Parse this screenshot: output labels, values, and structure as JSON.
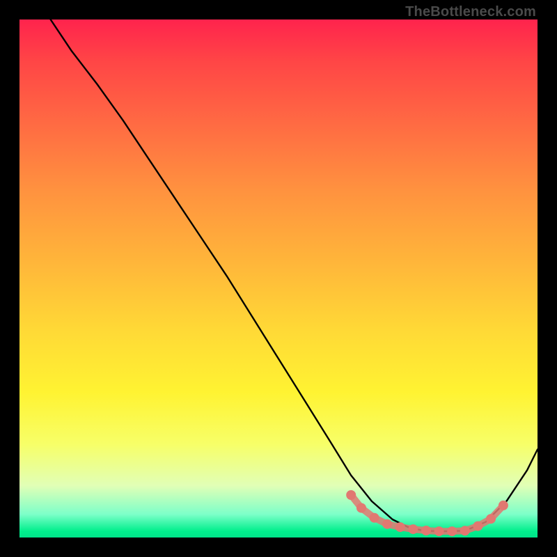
{
  "attribution": "TheBottleneck.com",
  "chart_data": {
    "type": "line",
    "title": "",
    "xlabel": "",
    "ylabel": "",
    "xlim": [
      0,
      100
    ],
    "ylim": [
      0,
      100
    ],
    "series": [
      {
        "name": "curve",
        "x": [
          6,
          10,
          15,
          20,
          25,
          30,
          35,
          40,
          45,
          50,
          55,
          60,
          64,
          68,
          72,
          75,
          78,
          82,
          86,
          90,
          94,
          98,
          100
        ],
        "y": [
          100,
          94,
          87.5,
          80.5,
          73,
          65.5,
          58,
          50.5,
          42.5,
          34.5,
          26.5,
          18.5,
          12,
          7,
          3.5,
          2,
          1.3,
          1.2,
          1.3,
          3,
          7,
          13,
          17
        ]
      }
    ],
    "markers": {
      "name": "salmon-dots",
      "color": "#e17871",
      "x": [
        64,
        66,
        68.5,
        71,
        73.5,
        76,
        78.5,
        81,
        83.5,
        86,
        88.5,
        91,
        93.4
      ],
      "y": [
        8.2,
        5.7,
        3.8,
        2.6,
        2.0,
        1.6,
        1.35,
        1.2,
        1.2,
        1.3,
        2.2,
        3.6,
        6.2
      ]
    },
    "gradient_stops": [
      {
        "pos": 0,
        "color": "#ff234d"
      },
      {
        "pos": 20,
        "color": "#ff6a43"
      },
      {
        "pos": 47,
        "color": "#ffb63a"
      },
      {
        "pos": 72,
        "color": "#fff332"
      },
      {
        "pos": 90,
        "color": "#e1ffb6"
      },
      {
        "pos": 98,
        "color": "#00ef8c"
      },
      {
        "pos": 100,
        "color": "#00e38a"
      }
    ]
  }
}
